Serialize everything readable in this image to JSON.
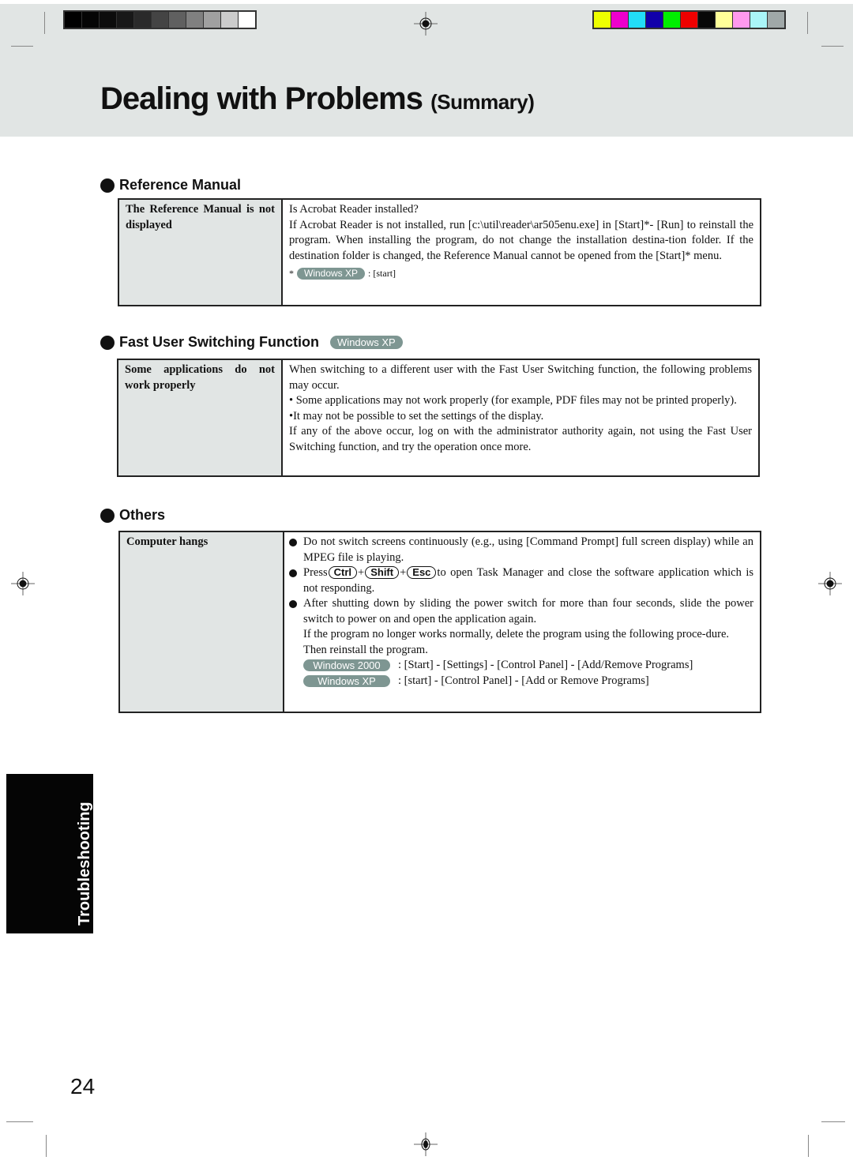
{
  "header": {
    "title": "Dealing with Problems",
    "subtitle": "(Summary)",
    "grayscale_swatches": [
      "#000000",
      "#050505",
      "#0c0c0c",
      "#181818",
      "#2a2a2a",
      "#444444",
      "#606060",
      "#808080",
      "#a0a0a0",
      "#cccccc",
      "#ffffff"
    ],
    "color_swatches": [
      "#eeff00",
      "#ee00cc",
      "#22ddf8",
      "#1100aa",
      "#00ee00",
      "#ee0000",
      "#080808",
      "#ffff99",
      "#ff99ee",
      "#aaf5f8",
      "#a0a8a8"
    ]
  },
  "sections": [
    {
      "heading": "Reference Manual",
      "problem": "The Reference Manual is not displayed",
      "solution": [
        "Is Acrobat Reader installed?",
        "If Acrobat Reader is not installed, run [c:\\util\\reader\\ar505enu.exe] in [Start]*- [Run] to reinstall the program.  When installing the program, do not change the installation destina-tion folder.  If the destination folder is changed, the Reference Manual cannot be opened from the [Start]* menu."
      ],
      "note": {
        "prefix": "*",
        "badge": "Windows XP",
        "text": ":  [start]"
      }
    },
    {
      "heading": "Fast User Switching Function",
      "badge": "Windows XP",
      "problem": "Some applications do not work properly",
      "solution": [
        "When switching to a different user with the Fast User Switching function, the following problems may occur.",
        "• Some applications may not work properly (for example, PDF files may not be printed properly).",
        "•It may not be possible to set the settings of the display.",
        "If any of the above occur, log on with the administrator authority again, not using the Fast User Switching function, and try the operation once more."
      ]
    },
    {
      "heading": "Others",
      "problem": "Computer hangs",
      "bullets": [
        {
          "text": "Do not switch screens continuously (e.g., using [Command Prompt] full screen display) while an MPEG file is playing."
        },
        {
          "prefix": "Press",
          "keys": [
            "Ctrl",
            "Shift",
            "Esc"
          ],
          "suffix": "to open Task Manager and close the software application which is not responding."
        },
        {
          "text": "After shutting down by sliding the power switch for more than four seconds, slide the power switch to power on and open the application again."
        }
      ],
      "extra": [
        "If the program no longer works normally, delete the program using the following proce-dure.",
        "Then reinstall the program."
      ],
      "paths": [
        {
          "badge": "Windows 2000",
          "text": ": [Start] - [Settings] - [Control Panel] - [Add/Remove Programs]"
        },
        {
          "badge": "Windows XP",
          "text": ": [start] - [Control Panel] - [Add or Remove Programs]"
        }
      ]
    }
  ],
  "side_tab": "Troubleshooting",
  "page_number": "24",
  "key_separator": "+"
}
